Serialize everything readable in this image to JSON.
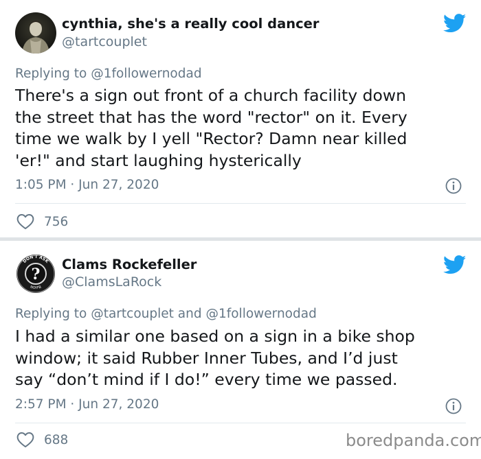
{
  "tweets": [
    {
      "display_name": "cynthia, she's a really cool dancer",
      "handle": "@tartcouplet",
      "reply_prefix": "Replying to",
      "reply_mentions": "@1followernodad",
      "text_lines": [
        "There's a sign out front of a church facility down",
        "the street that has the word \"rector\" on it. Every",
        "time we walk by I yell \"Rector? Damn near killed",
        "'er!\" and start laughing hysterically"
      ],
      "timestamp": "1:05 PM · Jun 27, 2020",
      "likes": "756"
    },
    {
      "display_name": "Clams Rockefeller",
      "handle": "@ClamsLaRock",
      "reply_prefix": "Replying to",
      "reply_mentions": "@tartcouplet and @1followernodad",
      "avatar_text_top": "DON'T ASK",
      "avatar_text_bottom": "NOYFB",
      "avatar_symbol": "?",
      "text_lines": [
        "I had a similar one based on a sign in a bike shop",
        "window; it said Rubber Inner Tubes, and I’d just",
        "say “don’t mind if I do!” every time we passed."
      ],
      "timestamp": "2:57 PM · Jun 27, 2020",
      "likes": "688"
    }
  ],
  "icons": {
    "brand": "bird-icon",
    "info": "info-icon",
    "like": "heart-icon"
  },
  "colors": {
    "twitter_blue": "#1da1f2",
    "secondary_text": "#657786",
    "primary_text": "#14171a",
    "divider": "#e1e8ed"
  },
  "watermark": "boredpanda.com"
}
